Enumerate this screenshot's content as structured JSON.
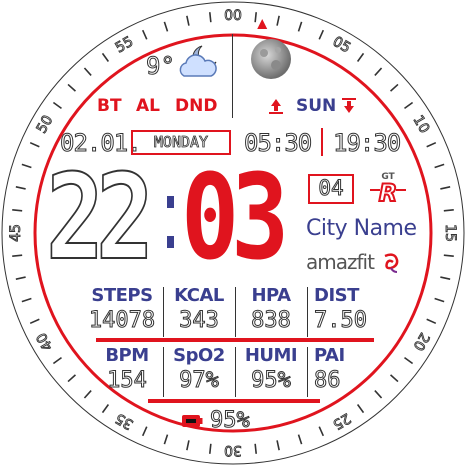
{
  "bezel": {
    "ticks": [
      "00",
      "05",
      "10",
      "15",
      "20",
      "25",
      "30",
      "35",
      "40",
      "45",
      "50",
      "55"
    ],
    "accent": "#e0141e"
  },
  "weather": {
    "temperature": "9°",
    "icon": "cloud-night-icon"
  },
  "moon": {
    "icon": "moon-phase-icon"
  },
  "status": {
    "bt": "BT",
    "al": "AL",
    "dnd": "DND"
  },
  "sun": {
    "label": "SUN",
    "rise_icon": "sunrise-icon",
    "set_icon": "sunset-icon"
  },
  "date": {
    "day_month": "02.01.",
    "weekday": "MONDAY"
  },
  "sun_times": {
    "rise": "05:30",
    "set": "19:30"
  },
  "time": {
    "hours": "22",
    "minutes": "03",
    "seconds": "04"
  },
  "brand": {
    "city": "City Name",
    "logo_text": "amazfit"
  },
  "stats_row1": [
    {
      "label": "STEPS",
      "value": "14078"
    },
    {
      "label": "KCAL",
      "value": "343"
    },
    {
      "label": "HPA",
      "value": "838"
    },
    {
      "label": "DIST",
      "value": "7.50"
    }
  ],
  "stats_row2": [
    {
      "label": "BPM",
      "value": "154"
    },
    {
      "label": "SpO2",
      "value": "97%"
    },
    {
      "label": "HUMI",
      "value": "95%"
    },
    {
      "label": "PAI",
      "value": "86"
    }
  ],
  "battery": {
    "value": "95%",
    "icon": "battery-icon"
  },
  "colors": {
    "accent": "#e0141e",
    "text": "#3a3f8f",
    "outline": "#333333"
  }
}
